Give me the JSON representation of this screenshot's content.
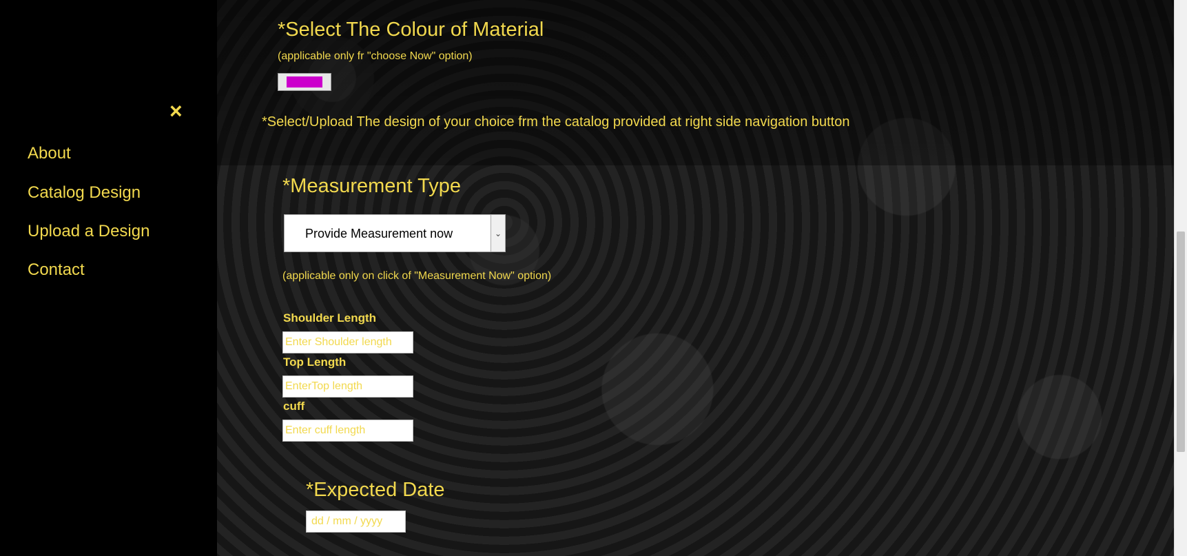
{
  "sidebar": {
    "close_icon": "×",
    "items": [
      {
        "label": "About"
      },
      {
        "label": "Catalog Design"
      },
      {
        "label": "Upload a Design"
      },
      {
        "label": "Contact"
      }
    ]
  },
  "colour_section": {
    "title": "*Select The Colour of Material",
    "note": "(applicable only fr \"choose Now\" option)",
    "selected_color": "#cc00cc"
  },
  "design_instruction": "*Select/Upload The design of your choice frm the catalog provided at right side navigation button",
  "measurement": {
    "title": "*Measurement Type",
    "selected_option": "Provide Measurement now",
    "note": "(applicable only on click of \"Measurement Now\" option)",
    "fields": [
      {
        "label": "Shoulder Length",
        "placeholder": "Enter Shoulder length",
        "value": ""
      },
      {
        "label": "Top Length",
        "placeholder": "EnterTop length",
        "value": ""
      },
      {
        "label": "cuff",
        "placeholder": "Enter cuff length",
        "value": ""
      }
    ]
  },
  "expected_date": {
    "title": "*Expected Date",
    "placeholder": "dd / mm / yyyy"
  },
  "colors": {
    "accent": "#f2d94e",
    "sidebar_bg": "#000000",
    "swatch": "#cc00cc"
  }
}
